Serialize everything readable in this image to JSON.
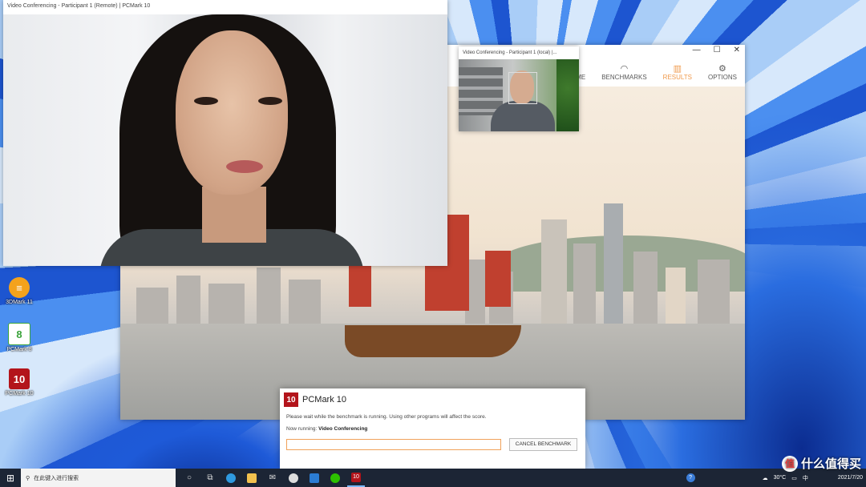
{
  "desktop_icons": [
    {
      "label": "3DMark 11"
    },
    {
      "label": "PCMark 8"
    },
    {
      "label": "PCMark 10",
      "glyph": "10"
    }
  ],
  "remote_window": {
    "title": "Video Conferencing - Participant 1 (Remote) | PCMark 10"
  },
  "local_window": {
    "title": "Video Conferencing - Participant 1 (local) |..."
  },
  "pcmark_nav": [
    {
      "label": "HOME",
      "icon": "home-icon"
    },
    {
      "label": "BENCHMARKS",
      "icon": "gauge-icon"
    },
    {
      "label": "RESULTS",
      "icon": "bar-chart-icon",
      "active": true
    },
    {
      "label": "OPTIONS",
      "icon": "gear-icon"
    }
  ],
  "dialog": {
    "logo": "10",
    "title": "PCMark 10",
    "message": "Please wait while the benchmark is running. Using other programs will affect the score.",
    "now_running_label": "Now running:",
    "now_running_value": "Video Conferencing",
    "cancel_label": "CANCEL BENCHMARK",
    "progress": 0
  },
  "taskbar": {
    "search_placeholder": "在此键入进行搜索",
    "app_icons": [
      "task-view-icon",
      "multitasking-icon",
      "edge-icon",
      "file-explorer-icon",
      "mail-icon",
      "chrome-icon",
      "word-icon",
      "wechat-icon",
      "pcmark-icon"
    ],
    "pcmark_glyph": "10",
    "weather": "30°C",
    "lang": "中",
    "date": "2021/7/20"
  },
  "watermark": "什么值得买",
  "colors": {
    "accent": "#f09a4c",
    "pcmark_red": "#b3141b",
    "taskbar": "#1c2535"
  }
}
